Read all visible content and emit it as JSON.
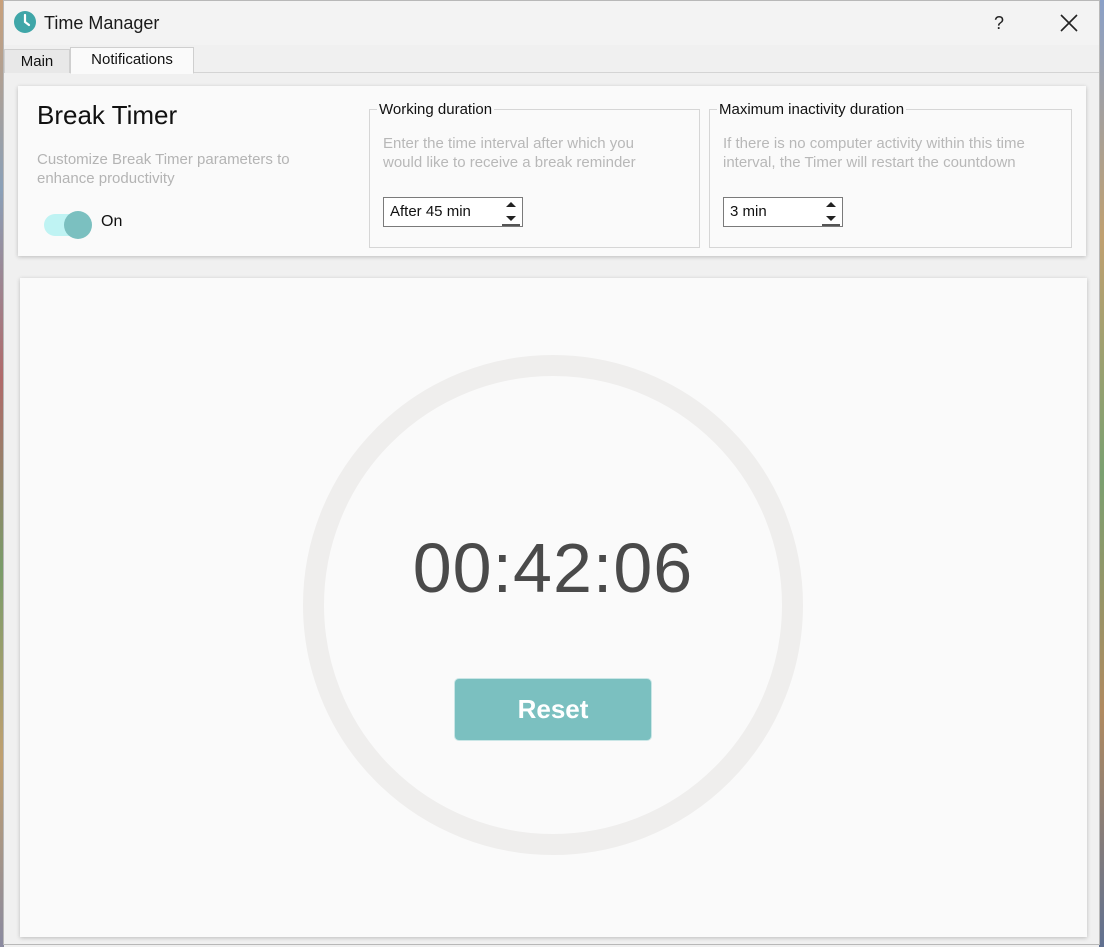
{
  "app": {
    "title": "Time Manager",
    "accent_color": "#7bc0c0",
    "icon": "clock-icon"
  },
  "window_controls": {
    "help_label": "?",
    "close_icon": "close-icon"
  },
  "tabs": [
    {
      "label": "Main",
      "selected": false
    },
    {
      "label": "Notifications",
      "selected": true
    }
  ],
  "break_timer": {
    "title": "Break Timer",
    "description": "Customize Break Timer parameters to enhance productivity",
    "toggle": {
      "state": "on",
      "label": "On"
    }
  },
  "working_duration": {
    "legend": "Working duration",
    "description_line1": "Enter the time interval after which you",
    "description_line2": "would like to receive a break reminder",
    "value": "After 45 min"
  },
  "inactivity_duration": {
    "legend": "Maximum inactivity duration",
    "description_line1": "If there is no computer activity within this time",
    "description_line2": "interval, the Timer will restart the countdown",
    "value": "3 min"
  },
  "timer": {
    "display": "00:42:06",
    "reset_label": "Reset"
  }
}
